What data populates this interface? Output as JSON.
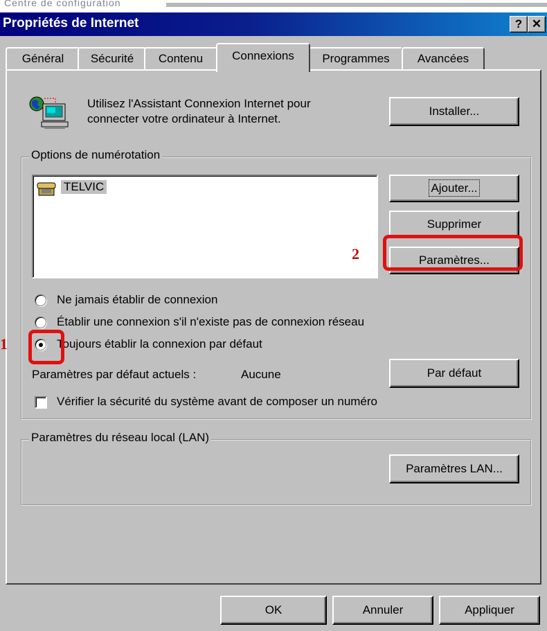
{
  "background_window": {
    "partial_title": "Centre de configuration"
  },
  "window": {
    "title": "Propriétés de Internet",
    "help_glyph": "?",
    "close_glyph": "✕"
  },
  "tabs": [
    {
      "label": "Général"
    },
    {
      "label": "Sécurité"
    },
    {
      "label": "Contenu"
    },
    {
      "label": "Connexions",
      "active": true
    },
    {
      "label": "Programmes"
    },
    {
      "label": "Avancées"
    }
  ],
  "wizard": {
    "icon": "network-computer-icon",
    "text_line1": "Utilisez l'Assistant Connexion Internet pour",
    "text_line2": "connecter votre ordinateur à Internet.",
    "install_button": "Installer..."
  },
  "dialup": {
    "group_label": "Options de numérotation",
    "connections": [
      {
        "name": "TELVIC",
        "icon": "dialup-connection-icon"
      }
    ],
    "add_button": "Ajouter...",
    "remove_button": "Supprimer",
    "settings_button": "Paramètres...",
    "radio_options": [
      {
        "label": "Ne jamais établir de connexion",
        "selected": false
      },
      {
        "label": "Établir une connexion s'il n'existe pas de connexion réseau",
        "selected": false
      },
      {
        "label": "Toujours établir la connexion par défaut",
        "selected": true
      }
    ],
    "default_label": "Paramètres par défaut actuels :",
    "default_value": "Aucune",
    "default_button": "Par défaut",
    "check_security_label": "Vérifier la sécurité du système avant de composer un numéro",
    "check_security_checked": false
  },
  "lan": {
    "group_label": "Paramètres du réseau local (LAN)",
    "lan_button": "Paramètres LAN..."
  },
  "footer": {
    "ok": "OK",
    "cancel": "Annuler",
    "apply": "Appliquer"
  },
  "annotations": {
    "marker_1": "1",
    "marker_2": "2",
    "highlight_color": "#e01010"
  }
}
